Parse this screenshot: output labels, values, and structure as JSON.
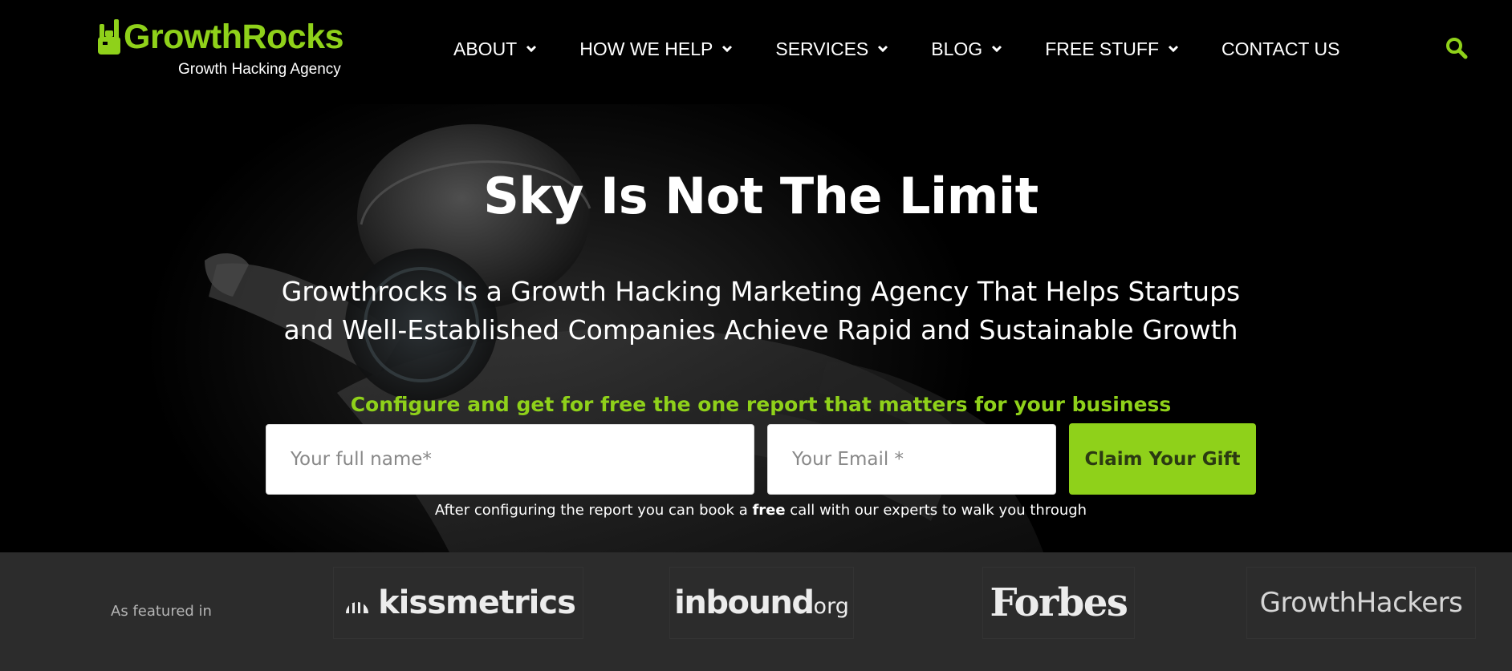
{
  "brand": {
    "name": "GrowthRocks",
    "tagline": "Growth Hacking Agency",
    "accent_color": "#8fd11a"
  },
  "nav": {
    "items": [
      {
        "label": "ABOUT",
        "has_dropdown": true
      },
      {
        "label": "HOW WE HELP",
        "has_dropdown": true
      },
      {
        "label": "SERVICES",
        "has_dropdown": true
      },
      {
        "label": "BLOG",
        "has_dropdown": true
      },
      {
        "label": "FREE STUFF",
        "has_dropdown": true
      },
      {
        "label": "CONTACT US",
        "has_dropdown": false
      }
    ],
    "search_icon": "search-icon"
  },
  "hero": {
    "title": "Sky Is Not The Limit",
    "subtitle_line1": "Growthrocks Is a Growth Hacking Marketing Agency That Helps Startups",
    "subtitle_line2": "and Well-Established Companies Achieve Rapid and Sustainable Growth"
  },
  "cta": {
    "heading": "Configure and get for free the one report that matters for your business",
    "name_placeholder": "Your full name*",
    "email_placeholder": "Your Email *",
    "button_label": "Claim Your Gift",
    "note_before": "After configuring the report you can book a ",
    "note_bold": "free",
    "note_after": " call with our experts to walk you through"
  },
  "featured": {
    "label": "As featured in",
    "logos": [
      {
        "name": "kissmetrics"
      },
      {
        "name": "inbound",
        "suffix": "org"
      },
      {
        "name": "Forbes"
      },
      {
        "name": "GrowthHackers"
      }
    ]
  }
}
